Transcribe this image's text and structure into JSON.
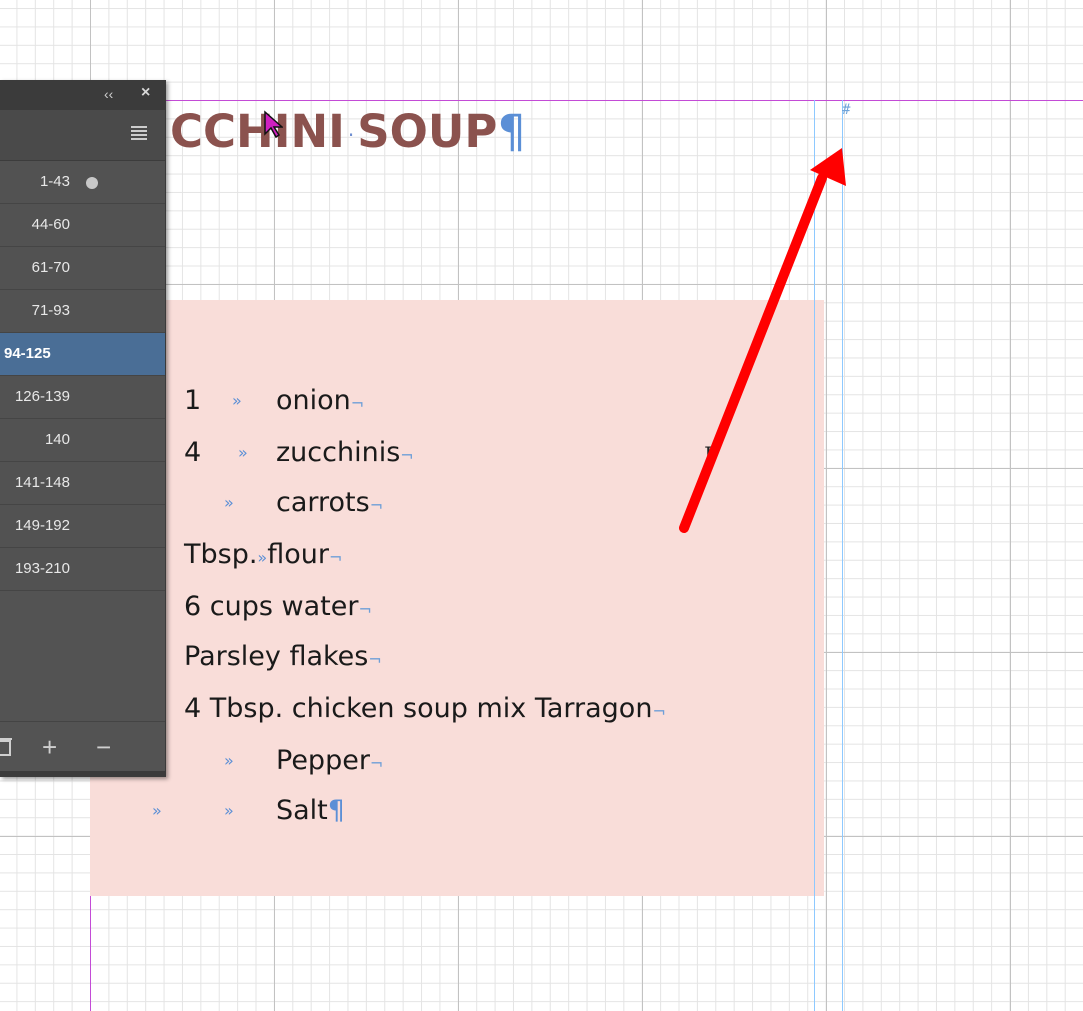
{
  "document": {
    "heading": "CCHINI SOUP",
    "heading_words": [
      "CCHINI",
      "SOUP"
    ],
    "pilcrow": "¶",
    "space_dot": "·",
    "tab_mark": "»",
    "line_end": "¬",
    "column_marker": "#",
    "colors": {
      "heading": "#8b524e",
      "frame_fill": "#f9ddd9",
      "margin_guide": "#c34bd6",
      "column_guide": "#8ec9ff",
      "annotation_arrow": "#ff0000"
    },
    "ingredient_lines": [
      {
        "qty": "1",
        "text": "onion"
      },
      {
        "qty": "4",
        "text": "zucchinis"
      },
      {
        "qty": "",
        "text": "carrots"
      },
      {
        "qty": "Tbsp.",
        "text": "flour"
      },
      {
        "qty": "",
        "text": "6 cups water"
      },
      {
        "qty": "",
        "text": "Parsley flakes"
      },
      {
        "qty": "",
        "text": "4 Tbsp. chicken soup mix Tarragon"
      },
      {
        "qty": "",
        "text": "Pepper"
      },
      {
        "qty": "",
        "text": "Salt"
      }
    ]
  },
  "panel": {
    "collapse_icon": "‹‹",
    "close_icon": "×",
    "menu_icon": "hamburger-menu",
    "ranges": [
      "1-43",
      "44-60",
      "61-70",
      "71-93",
      "94-125",
      "126-139",
      "140",
      "141-148",
      "149-192",
      "193-210"
    ],
    "selected_range": "94-125",
    "footer_buttons": [
      "trash-icon",
      "+",
      "−"
    ]
  }
}
